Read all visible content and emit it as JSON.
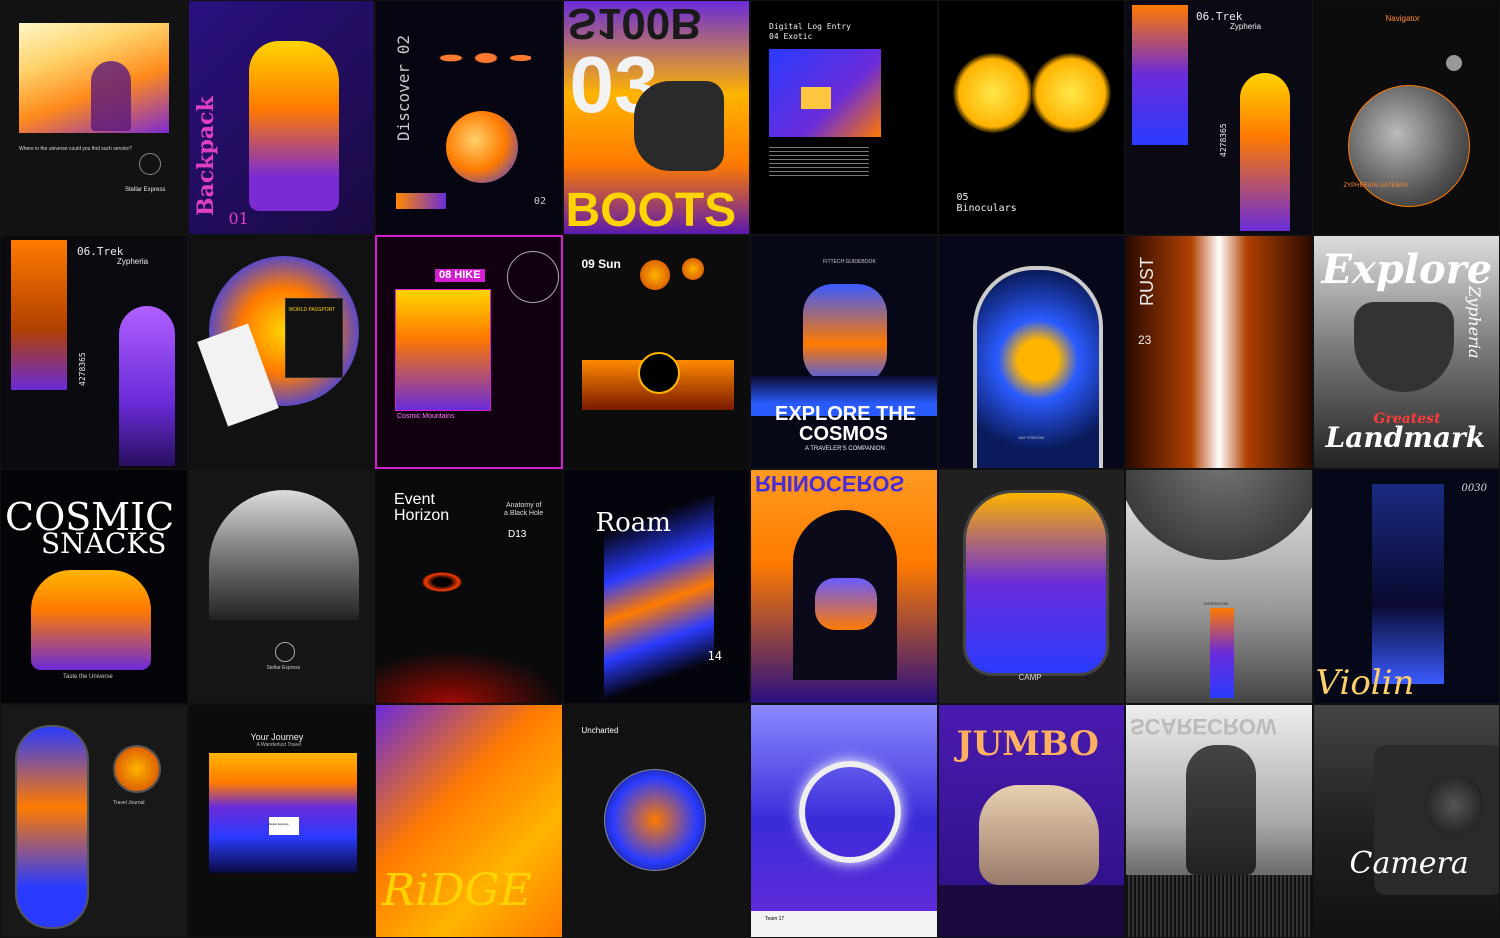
{
  "tiles": [
    {
      "id": 1,
      "caption": "Where in the universe could you find such service?",
      "brand": "Stellar Express"
    },
    {
      "id": 2,
      "title": "Backpack",
      "number": "01"
    },
    {
      "id": 3,
      "title": "Discover 02",
      "number": "02"
    },
    {
      "id": 4,
      "title_top": "S100B",
      "title_mid": "03",
      "title_bottom": "BOOTS"
    },
    {
      "id": 5,
      "header": "Digital Log Entry",
      "sub": "04 Exotic"
    },
    {
      "id": 6,
      "number": "05",
      "title": "Binoculars"
    },
    {
      "id": 7,
      "title": "06.Trek",
      "brand": "Zypheria",
      "code": "4278365"
    },
    {
      "id": 8,
      "title": "Navigator",
      "footer": "ZYPHERIAN GATEWAY"
    },
    {
      "id": 9,
      "title": "06.Trek",
      "brand": "Zypheria",
      "code": "4278365"
    },
    {
      "id": 10,
      "label": "WORLD PASSPORT"
    },
    {
      "id": 11,
      "title": "08 HIKE",
      "sub": "Cosmic Mountains"
    },
    {
      "id": 12,
      "title": "09 Sun"
    },
    {
      "id": 13,
      "header": "FITTECH GUIDEBOOK",
      "title1": "EXPLORE THE",
      "title2": "COSMOS",
      "sub": "A TRAVELER'S COMPANION"
    },
    {
      "id": 14,
      "label": "SAY STATION"
    },
    {
      "id": 15,
      "title": "RUST",
      "number": "23"
    },
    {
      "id": 16,
      "title": "Explore",
      "brand": "Zypheria",
      "sub1": "Greatest",
      "sub2": "Landmark"
    },
    {
      "id": 17,
      "title1": "COSMIC",
      "title2": "SNACKS",
      "footer": "Taste the Universe"
    },
    {
      "id": 18,
      "brand": "Stellar Express"
    },
    {
      "id": 19,
      "title1": "Event",
      "title2": "Horizon",
      "sub1": "Anatomy of",
      "sub2": "a Black Hole",
      "code": "D13"
    },
    {
      "id": 20,
      "title": "Roam",
      "number": "14"
    },
    {
      "id": 21,
      "title": "RHINOCEROS"
    },
    {
      "id": 22,
      "title": "CAMP"
    },
    {
      "id": 23,
      "label": "EXPEDITION"
    },
    {
      "id": 24,
      "number": "0030",
      "title": "Violin"
    },
    {
      "id": 25,
      "label": "Travel Journal"
    },
    {
      "id": 26,
      "title": "Your Journey",
      "sub": "A Wanderlust Travel",
      "brand": "Stellar Express"
    },
    {
      "id": 27,
      "title": "RiDGE"
    },
    {
      "id": 28,
      "title": "Uncharted"
    },
    {
      "id": 29,
      "label": "Team 17"
    },
    {
      "id": 30,
      "title": "JUMBO"
    },
    {
      "id": 31,
      "title": "SCARECROW"
    },
    {
      "id": 32,
      "title": "Camera"
    }
  ],
  "colors": {
    "orange": "#ff8a00",
    "yellow": "#ffd400",
    "blue": "#2a3bff",
    "purple": "#6a2bd9",
    "magenta": "#d21fd0",
    "black": "#0a0a0c"
  }
}
